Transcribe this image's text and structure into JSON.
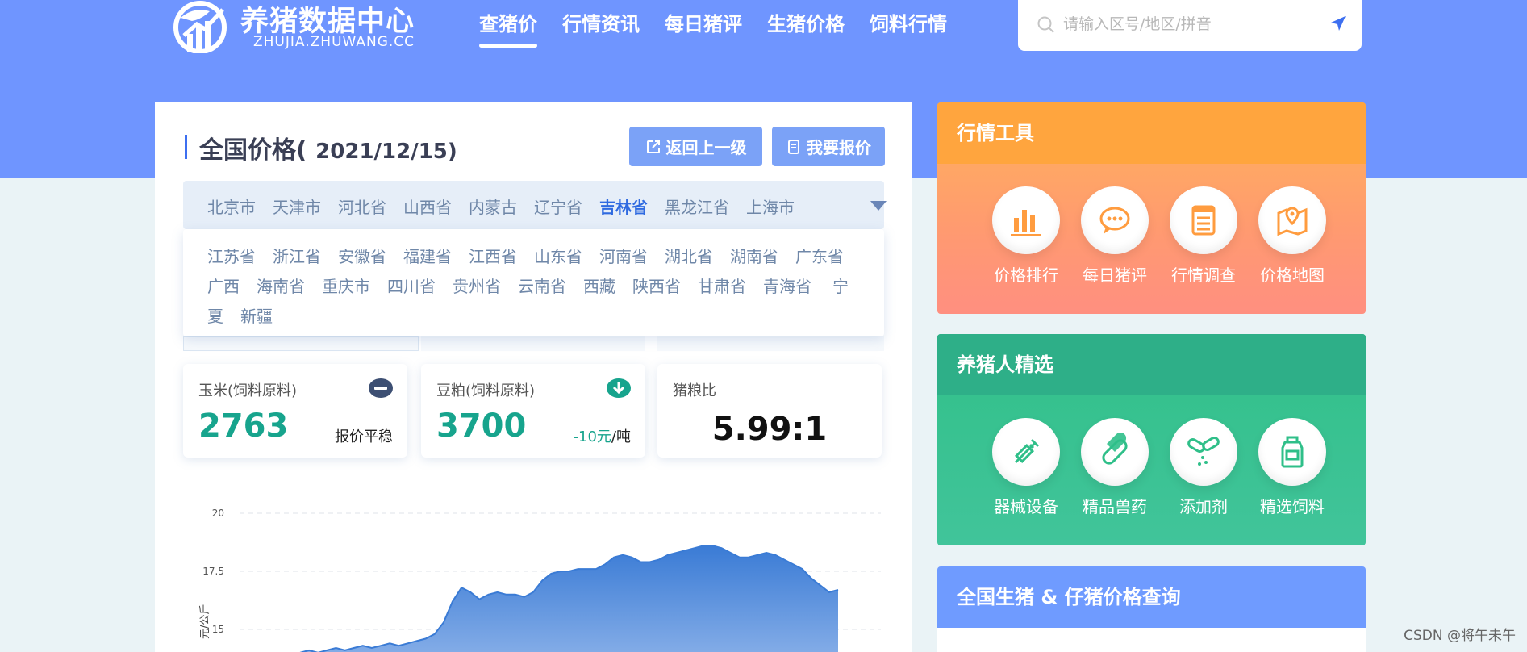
{
  "brand": {
    "title": "养猪数据中心",
    "subtitle": "ZHUJIA.ZHUWANG.CC"
  },
  "nav": {
    "items": [
      {
        "label": "查猪价",
        "active": true
      },
      {
        "label": "行情资讯",
        "active": false
      },
      {
        "label": "每日猪评",
        "active": false
      },
      {
        "label": "生猪价格",
        "active": false
      },
      {
        "label": "饲料行情",
        "active": false
      }
    ]
  },
  "search": {
    "placeholder": "请输入区号/地区/拼音",
    "value": ""
  },
  "main": {
    "title": "全国价格(",
    "date": "2021/12/15)",
    "back_label": "返回上一级",
    "report_label": "我要报价",
    "provinces_row": [
      "北京市",
      "天津市",
      "河北省",
      "山西省",
      "内蒙古",
      "辽宁省",
      "吉林省",
      "黑龙江省",
      "上海市"
    ],
    "active_province": "吉林省",
    "dropdown_rows": [
      [
        "江苏省",
        "浙江省",
        "安徽省",
        "福建省",
        "江西省",
        "山东省",
        "河南省",
        "湖北省",
        "湖南省",
        "广东省"
      ],
      [
        "广西",
        "海南省",
        "重庆市",
        "四川省",
        "贵州省",
        "云南省",
        "西藏",
        "陕西省",
        "甘肃省",
        "青海省",
        "宁"
      ],
      [
        "夏",
        "新疆"
      ]
    ]
  },
  "stats": {
    "corn": {
      "label": "玉米(饲料原料)",
      "value": "2763",
      "note": "报价平稳",
      "icon": "minus-circle-icon"
    },
    "soy": {
      "label": "豆粕(饲料原料)",
      "value": "3700",
      "change": "-10元",
      "unit": "/吨",
      "icon": "down-arrow-circle-icon"
    },
    "ratio": {
      "label": "猪粮比",
      "value": "5.99:1"
    }
  },
  "chart_data": {
    "type": "area",
    "ylabel": "元/公斤",
    "yticks": [
      "20",
      "17.5",
      "15"
    ],
    "ylim": [
      14.5,
      20
    ],
    "x": [
      0,
      1,
      2,
      3,
      4,
      5,
      6,
      7,
      8,
      9,
      10,
      11,
      12,
      13,
      14,
      15,
      16,
      17,
      18,
      19,
      20,
      21,
      22,
      23,
      24,
      25,
      26,
      27,
      28,
      29,
      30,
      31,
      32,
      33,
      34,
      35,
      36,
      37,
      38,
      39,
      40,
      41,
      42,
      43,
      44,
      45,
      46,
      47,
      48,
      49,
      50,
      51,
      52,
      53,
      54,
      55,
      56,
      57,
      58,
      59,
      60,
      61,
      62,
      63,
      64,
      65,
      66,
      67,
      68,
      69,
      70,
      71
    ],
    "values": [
      14.0,
      14.1,
      14.0,
      14.1,
      14.2,
      14.1,
      14.2,
      14.3,
      14.2,
      14.3,
      14.4,
      14.3,
      14.4,
      14.5,
      14.6,
      14.8,
      15.3,
      16.2,
      16.8,
      16.6,
      16.3,
      16.5,
      16.6,
      16.5,
      16.5,
      16.4,
      16.6,
      17.1,
      17.4,
      17.5,
      17.5,
      17.6,
      17.6,
      17.6,
      17.8,
      18.1,
      18.2,
      18.1,
      17.9,
      17.9,
      18.0,
      18.2,
      18.3,
      18.4,
      18.5,
      18.6,
      18.6,
      18.5,
      18.3,
      18.1,
      18.1,
      18.2,
      18.3,
      18.2,
      18.0,
      17.8,
      17.6,
      17.2,
      16.9,
      16.6,
      16.7
    ],
    "color": "#3a7bd5"
  },
  "tools": {
    "title": "行情工具",
    "items": [
      {
        "label": "价格排行",
        "icon": "bar-chart-icon"
      },
      {
        "label": "每日猪评",
        "icon": "chat-bubble-icon"
      },
      {
        "label": "行情调查",
        "icon": "list-document-icon"
      },
      {
        "label": "价格地图",
        "icon": "map-pin-icon"
      }
    ]
  },
  "picks": {
    "title": "养猪人精选",
    "items": [
      {
        "label": "器械设备",
        "icon": "syringe-icon"
      },
      {
        "label": "精品兽药",
        "icon": "capsule-icon"
      },
      {
        "label": "添加剂",
        "icon": "pills-icon"
      },
      {
        "label": "精选饲料",
        "icon": "feed-bottle-icon"
      }
    ]
  },
  "query": {
    "title": "全国生猪 & 仔猪价格查询"
  },
  "watermark": "CSDN @将午未午",
  "colors": {
    "header": "#6f95ff",
    "accent": "#2f6ae0",
    "green": "#17a48d",
    "orange": "#ffa53e",
    "teal": "#2eaf88"
  }
}
